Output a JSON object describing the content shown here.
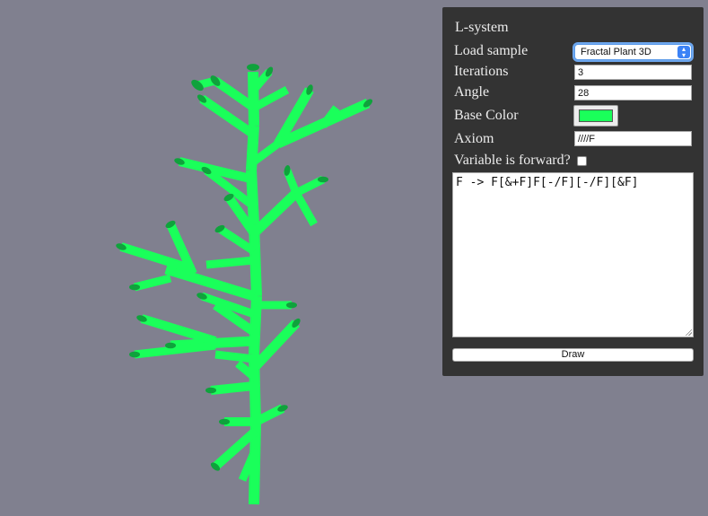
{
  "panel": {
    "title": "L-system",
    "load_sample_label": "Load sample",
    "load_sample_value": "Fractal Plant 3D",
    "iterations_label": "Iterations",
    "iterations_value": "3",
    "angle_label": "Angle",
    "angle_value": "28",
    "base_color_label": "Base Color",
    "base_color_value": "#1aff5a",
    "axiom_label": "Axiom",
    "axiom_value": "////F",
    "forward_label": "Variable is forward?",
    "forward_checked": false,
    "rules_text": "F -> F[&+F]F[-/F][-/F][&F]",
    "draw_label": "Draw"
  },
  "scene": {
    "background": "#80808f",
    "plant_color": "#1aff5a",
    "plant_shadow_color": "#0fa23c"
  }
}
